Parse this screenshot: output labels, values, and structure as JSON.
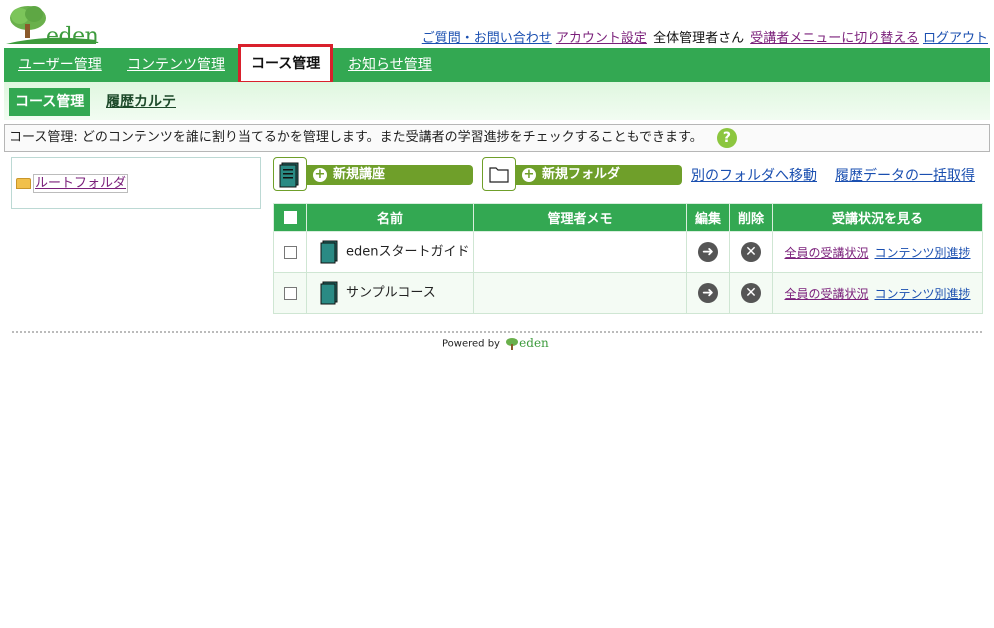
{
  "header": {
    "logo_text": "eden",
    "links": [
      {
        "label": "ご質問・お問い合わせ",
        "visited": false
      },
      {
        "label": "アカウント設定",
        "visited": true
      }
    ],
    "user_label": "全体管理者さん",
    "switch_link": "受講者メニューに切り替える",
    "logout_link": "ログアウト"
  },
  "nav": {
    "tabs": [
      {
        "label": "ユーザー管理"
      },
      {
        "label": "コンテンツ管理"
      },
      {
        "label": "コース管理",
        "active": true
      },
      {
        "label": "お知らせ管理"
      }
    ]
  },
  "subnav": {
    "items": [
      {
        "label": "コース管理",
        "active": true
      },
      {
        "label": "履歴カルテ"
      }
    ]
  },
  "description": {
    "text": "コース管理: どのコンテンツを誰に割り当てるかを管理します。また受講者の学習進捗をチェックすることもできます。",
    "help_icon": "?"
  },
  "folder_tree": {
    "root_label": "ルートフォルダ"
  },
  "actions": {
    "new_course": "新規講座",
    "new_folder": "新規フォルダ",
    "move_folder": "別のフォルダへ移動",
    "bulk_history": "履歴データの一括取得"
  },
  "table": {
    "headers": {
      "name": "名前",
      "memo": "管理者メモ",
      "edit": "編集",
      "delete": "削除",
      "status": "受講状況を見る"
    },
    "rows": [
      {
        "name": "edenスタートガイド",
        "memo": "",
        "all_status": "全員の受講状況",
        "content_progress": "コンテンツ別進捗"
      },
      {
        "name": "サンプルコース",
        "memo": "",
        "all_status": "全員の受講状況",
        "content_progress": "コンテンツ別進捗"
      }
    ]
  },
  "footer": {
    "powered_by": "Powered by",
    "logo_text": "eden"
  },
  "colors": {
    "primary_green": "#33a852",
    "button_green": "#6f9f2a",
    "highlight_red": "#d9202c"
  }
}
